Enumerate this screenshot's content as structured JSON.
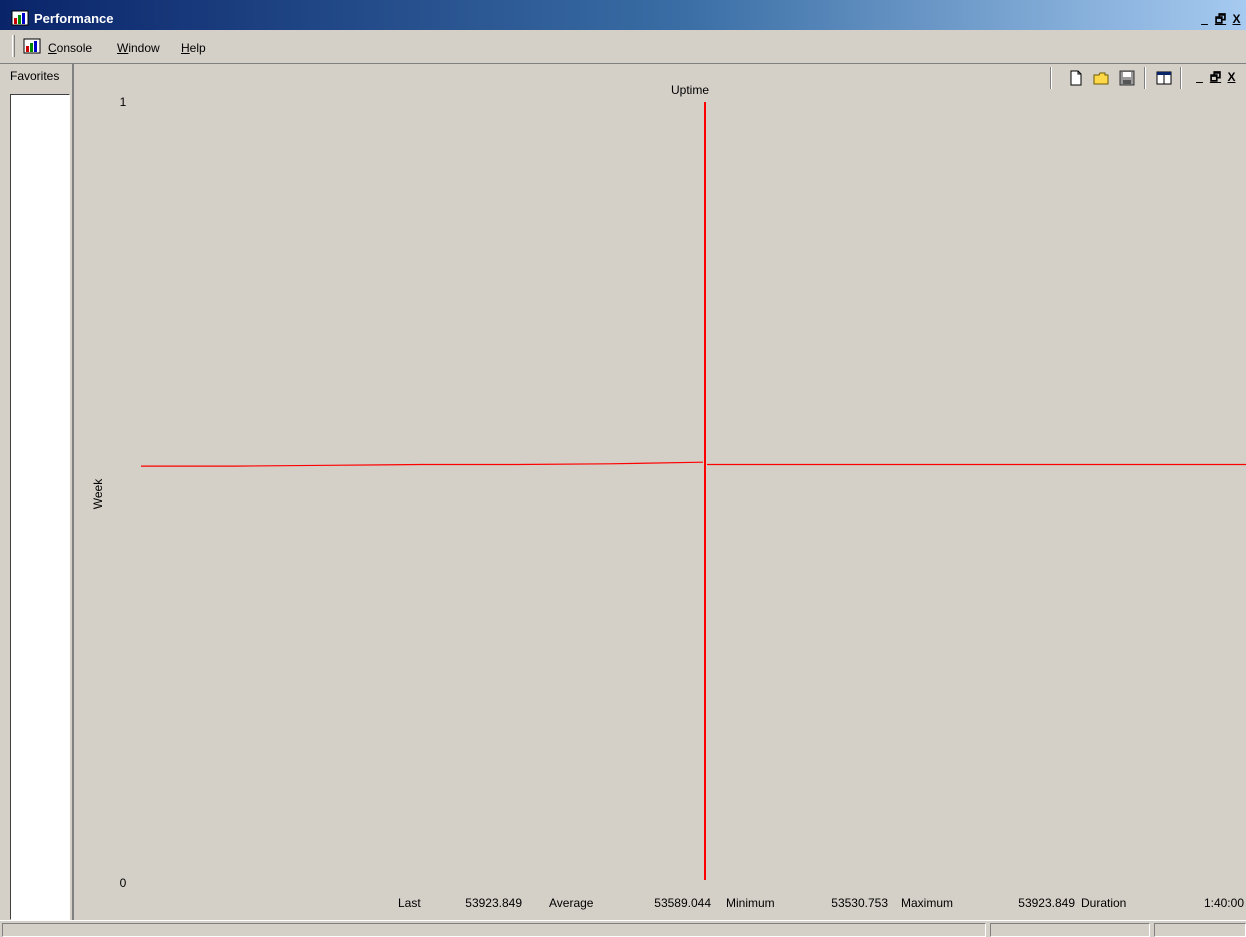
{
  "window": {
    "title": "Performance"
  },
  "menu": {
    "console": {
      "accel": "C",
      "rest": "onsole"
    },
    "window": {
      "accel": "W",
      "rest": "indow"
    },
    "help": {
      "accel": "H",
      "rest": "elp"
    }
  },
  "favorites": {
    "label": "Favorites"
  },
  "chart_data": {
    "type": "line",
    "title": "Uptime",
    "ylabel": "Week",
    "ylim": [
      0,
      1
    ],
    "y_ticks": [
      "1",
      "0"
    ],
    "series": [
      {
        "values_before_gap": [
          0.532,
          0.532,
          0.533,
          0.534,
          0.534,
          0.535,
          0.537
        ],
        "values_after_gap": [
          0.534,
          0.534,
          0.534,
          0.534
        ]
      }
    ],
    "current_position_marker": true,
    "color": "#ff0000"
  },
  "stats": {
    "last_label": "Last",
    "last_value": "53923.849",
    "average_label": "Average",
    "average_value": "53589.044",
    "minimum_label": "Minimum",
    "minimum_value": "53530.753",
    "maximum_label": "Maximum",
    "maximum_value": "53923.849",
    "duration_label": "Duration",
    "duration_value": "1:40:00"
  }
}
